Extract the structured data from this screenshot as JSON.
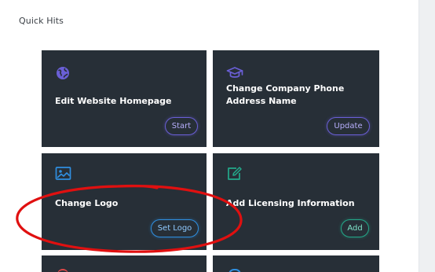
{
  "section": {
    "title": "Quick Hits"
  },
  "cards": [
    {
      "title": "Edit Website Homepage",
      "button": "Start",
      "icon": "globe-icon",
      "accent": "#6a5fd6"
    },
    {
      "title": "Change Company Phone Address Name",
      "button": "Update",
      "icon": "graduation-cap-icon",
      "accent": "#6a5fd6"
    },
    {
      "title": "Change Logo",
      "button": "Set Logo",
      "icon": "image-icon",
      "accent": "#2f8fe0"
    },
    {
      "title": "Add Licensing Information",
      "button": "Add",
      "icon": "edit-icon",
      "accent": "#23a98a"
    },
    {
      "icon": "red-icon",
      "accent": "#e04848"
    },
    {
      "icon": "blue-icon",
      "accent": "#2f8fe0"
    }
  ],
  "annotation": {
    "color": "#e01010"
  }
}
